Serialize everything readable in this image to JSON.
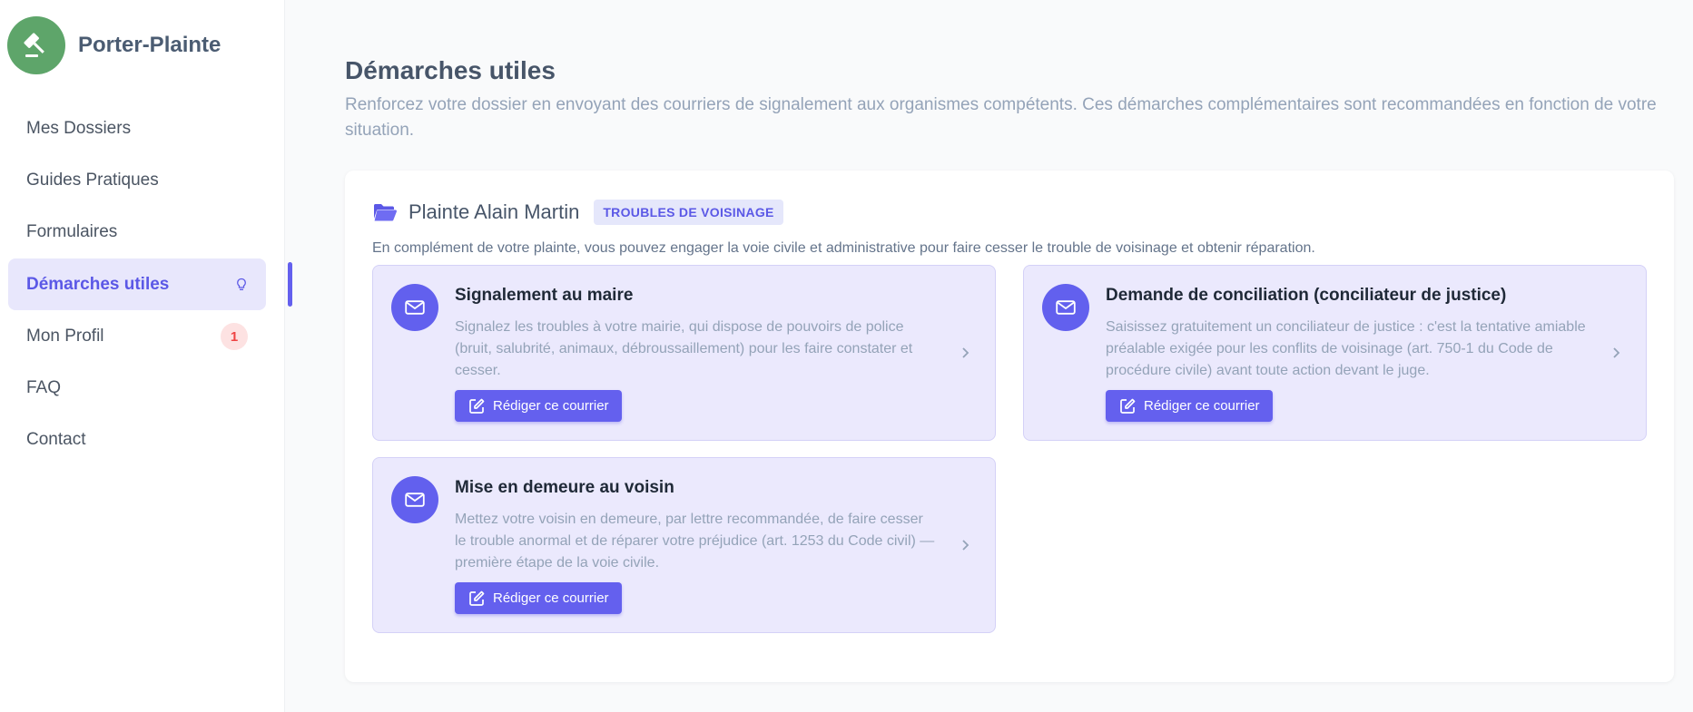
{
  "brand": {
    "name": "Porter-Plainte"
  },
  "sidebar": {
    "items": [
      {
        "label": "Mes Dossiers"
      },
      {
        "label": "Guides Pratiques"
      },
      {
        "label": "Formulaires"
      },
      {
        "label": "Démarches utiles",
        "active": true,
        "icon": "lightbulb-icon"
      },
      {
        "label": "Mon Profil",
        "badge": "1"
      },
      {
        "label": "FAQ"
      },
      {
        "label": "Contact"
      }
    ]
  },
  "page": {
    "title": "Démarches utiles",
    "subtitle": "Renforcez votre dossier en envoyant des courriers de signalement aux organismes compétents. Ces démarches complémentaires sont recommandées en fonction de votre situation."
  },
  "case": {
    "title": "Plainte Alain Martin",
    "tag": "TROUBLES DE VOISINAGE",
    "description": "En complément de votre plainte, vous pouvez engager la voie civile et administrative pour faire cesser le trouble de voisinage et obtenir réparation.",
    "steps": [
      {
        "title": "Signalement au maire",
        "text": "Signalez les troubles à votre mairie, qui dispose de pouvoirs de police (bruit, salubrité, animaux, débroussaillement) pour les faire constater et cesser.",
        "button": "Rédiger ce courrier"
      },
      {
        "title": "Demande de conciliation (conciliateur de justice)",
        "text": "Saisissez gratuitement un conciliateur de justice : c'est la tentative amiable préalable exigée pour les conflits de voisinage (art. 750-1 du Code de procédure civile) avant toute action devant le juge.",
        "button": "Rédiger ce courrier"
      },
      {
        "title": "Mise en demeure au voisin",
        "text": "Mettez votre voisin en demeure, par lettre recommandée, de faire cesser le trouble anormal et de réparer votre préjudice (art. 1253 du Code civil) — première étape de la voie civile.",
        "button": "Rédiger ce courrier"
      }
    ]
  },
  "colors": {
    "accent": "#6460ee",
    "brand": "#5ea56a",
    "badge": "#ef4444"
  }
}
